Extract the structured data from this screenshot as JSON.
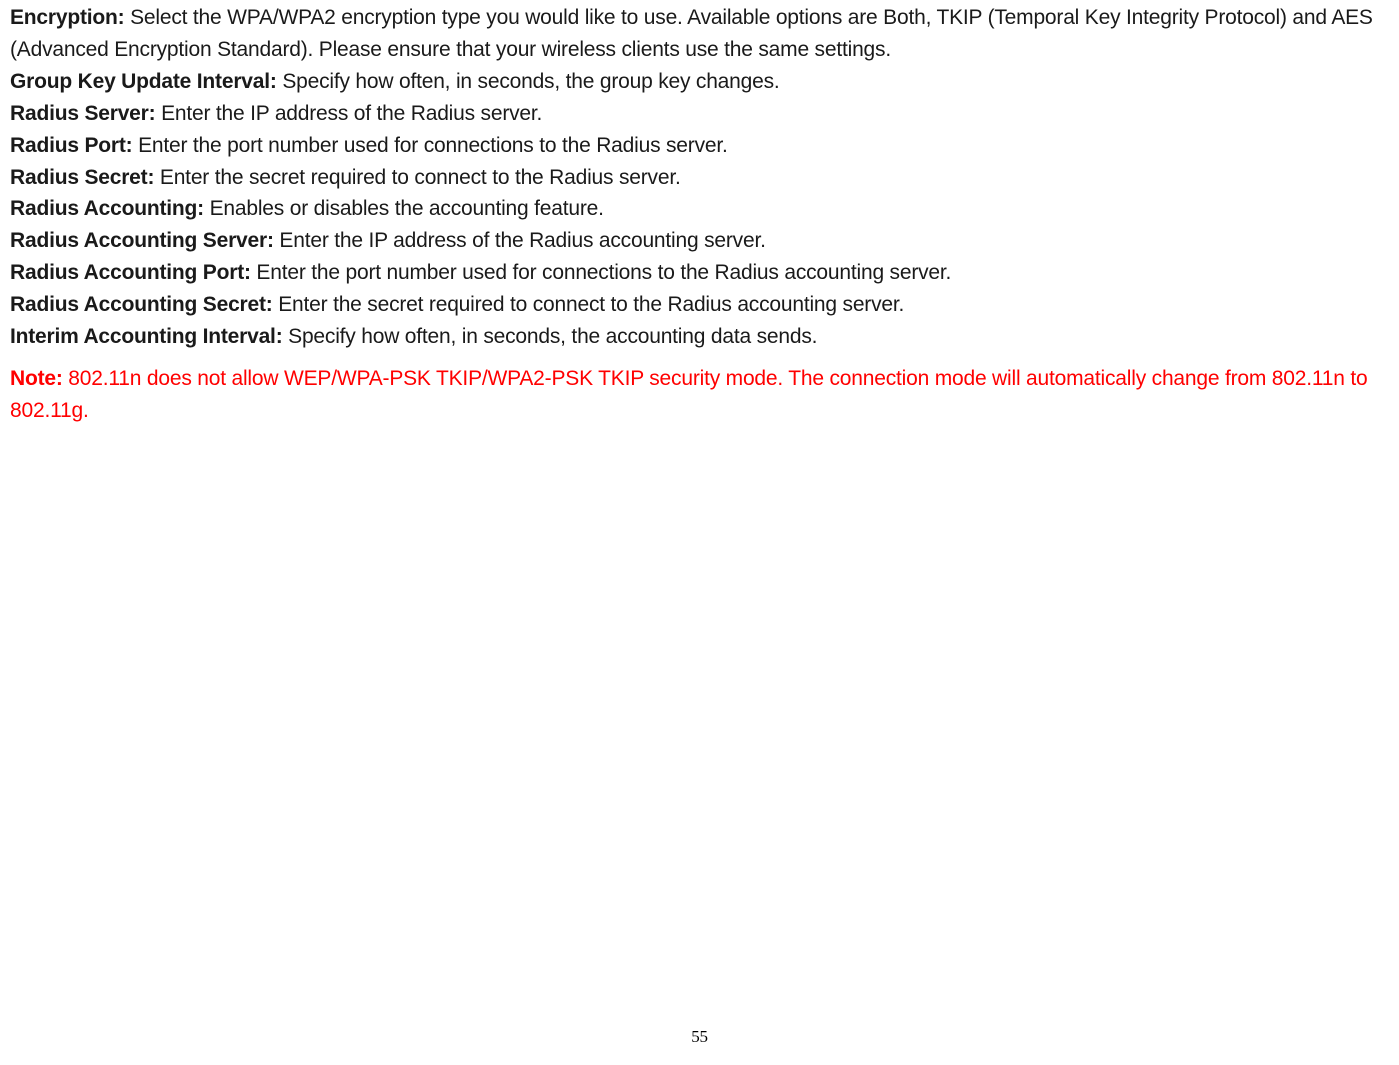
{
  "items": [
    {
      "label": "Encryption:",
      "desc": " Select the WPA/WPA2 encryption type you would like to use. Available options are Both, TKIP (Temporal Key Integrity Protocol) and AES (Advanced Encryption Standard). Please ensure that your wireless clients use the same settings."
    },
    {
      "label": "Group Key Update Interval:",
      "desc": " Specify how often, in seconds, the group key changes."
    },
    {
      "label": "Radius Server:",
      "desc": " Enter the IP address of the Radius server."
    },
    {
      "label": "Radius Port:",
      "desc": " Enter the port number used for connections to the Radius server."
    },
    {
      "label": "Radius Secret:",
      "desc": " Enter the secret required to connect to the Radius server."
    },
    {
      "label": "Radius Accounting:",
      "desc": " Enables or disables the accounting feature."
    },
    {
      "label": "Radius Accounting Server:",
      "desc": " Enter the IP address of the Radius accounting server."
    },
    {
      "label": "Radius Accounting Port:",
      "desc": " Enter the port number used for connections to the Radius accounting server."
    },
    {
      "label": "Radius Accounting Secret:",
      "desc": " Enter the secret required to connect to the Radius accounting server."
    },
    {
      "label": "Interim Accounting Interval:",
      "desc": " Specify how often, in seconds, the accounting data sends."
    }
  ],
  "note": {
    "label": "Note:",
    "text": " 802.11n does not allow WEP/WPA-PSK TKIP/WPA2-PSK TKIP security mode. The connection mode will automatically change from 802.11n to 802.11g."
  },
  "page_number": "55"
}
